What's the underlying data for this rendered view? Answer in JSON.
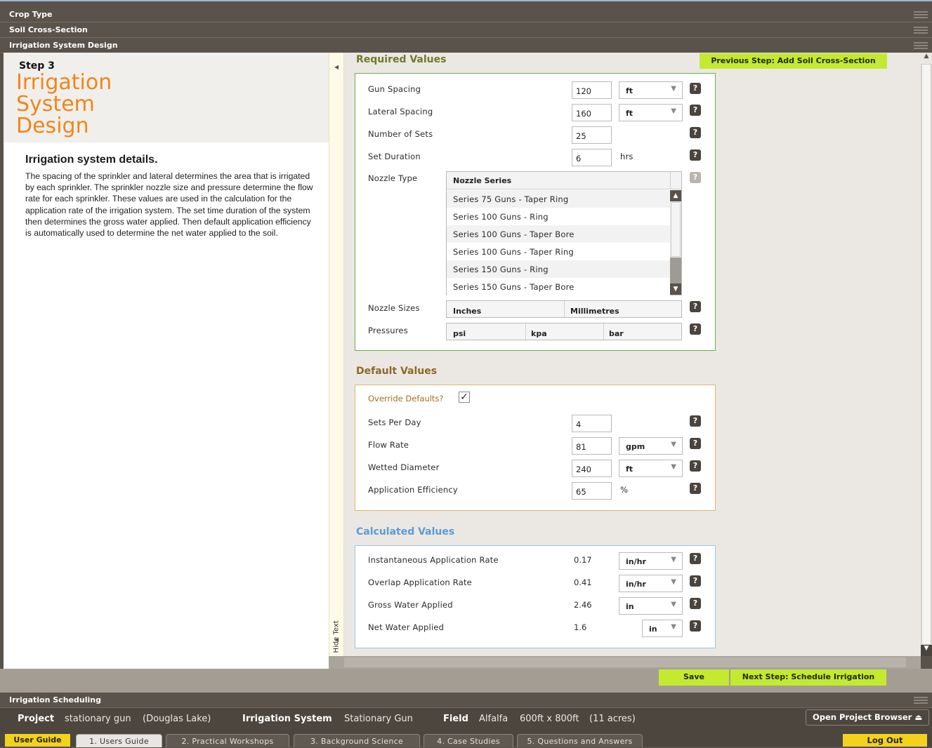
{
  "accordion": {
    "crop_type": "Crop Type",
    "soil": "Soil Cross-Section",
    "irrigation_design": "Irrigation System Design",
    "irrigation_scheduling": "Irrigation Scheduling"
  },
  "left_panel": {
    "step": "Step 3",
    "title_line1": "Irrigation",
    "title_line2": "System",
    "title_line3": "Design",
    "heading": "Irrigation system details.",
    "body": "The spacing of the sprinkler and lateral determines the area that is irrigated by each sprinkler. The sprinkler nozzle size and pressure determine the flow rate for each sprinkler. These values are used in the calculation for the application rate of the irrigation system. The set time duration of the system then determines the gross water applied. Then default application efficiency is automatically used to determine the net water applied to the soil.",
    "hide_text": "Hide Text"
  },
  "required": {
    "title": "Required Values",
    "prev_button": "Previous Step: Add Soil Cross-Section",
    "gun_spacing_label": "Gun Spacing",
    "gun_spacing_value": "120",
    "gun_spacing_unit": "ft",
    "lateral_spacing_label": "Lateral Spacing",
    "lateral_spacing_value": "160",
    "lateral_spacing_unit": "ft",
    "sets_label": "Number of Sets",
    "sets_value": "25",
    "duration_label": "Set Duration",
    "duration_value": "6",
    "duration_unit": "hrs",
    "nozzle_type_label": "Nozzle Type",
    "nozzle_series_header": "Nozzle Series",
    "nozzle_list": [
      "Series 75 Guns - Taper Ring",
      "Series 100 Guns - Ring",
      "Series 100 Guns - Taper Bore",
      "Series 100 Guns - Taper Ring",
      "Series 150 Guns - Ring",
      "Series 150 Guns - Taper Bore"
    ],
    "nozzle_sizes_label": "Nozzle Sizes",
    "inches": "Inches",
    "millimetres": "Millimetres",
    "pressures_label": "Pressures",
    "psi": "psi",
    "kpa": "kpa",
    "bar": "bar"
  },
  "defaults": {
    "title": "Default Values",
    "override_label": "Override Defaults?",
    "override_checked": true,
    "sets_per_day_label": "Sets Per Day",
    "sets_per_day_value": "4",
    "flow_rate_label": "Flow Rate",
    "flow_rate_value": "81",
    "flow_rate_unit": "gpm",
    "wetted_label": "Wetted Diameter",
    "wetted_value": "240",
    "wetted_unit": "ft",
    "efficiency_label": "Application Efficiency",
    "efficiency_value": "65",
    "efficiency_unit": "%"
  },
  "calculated": {
    "title": "Calculated Values",
    "inst_label": "Instantaneous Application Rate",
    "inst_value": "0.17",
    "inst_unit": "in/hr",
    "overlap_label": "Overlap Application Rate",
    "overlap_value": "0.41",
    "overlap_unit": "in/hr",
    "gross_label": "Gross Water Applied",
    "gross_value": "2.46",
    "gross_unit": "in",
    "net_label": "Net Water Applied",
    "net_value": "1.6",
    "net_unit": "in"
  },
  "actions": {
    "save": "Save",
    "next": "Next Step: Schedule Irrigation"
  },
  "status": {
    "project_label": "Project",
    "project_value": "stationary gun",
    "project_location": "(Douglas Lake)",
    "system_label": "Irrigation System",
    "system_value": "Stationary Gun",
    "field_label": "Field",
    "field_crop": "Alfalfa",
    "field_size": "600ft x 800ft",
    "field_acres": "(11 acres)",
    "open_browser": "Open Project Browser"
  },
  "guide": {
    "label": "User Guide",
    "tabs": [
      "1. Users Guide",
      "2. Practical Workshops",
      "3. Background Science",
      "4. Case Studies",
      "5. Questions and Answers"
    ],
    "logout": "Log Out"
  },
  "colors": {
    "accent_orange": "#f0861a",
    "green_button": "#c3ea31",
    "required_border": "#6bb049",
    "default_border": "#e0b66a",
    "calc_border": "#9cc4e4",
    "calc_title": "#5b9bd5"
  }
}
